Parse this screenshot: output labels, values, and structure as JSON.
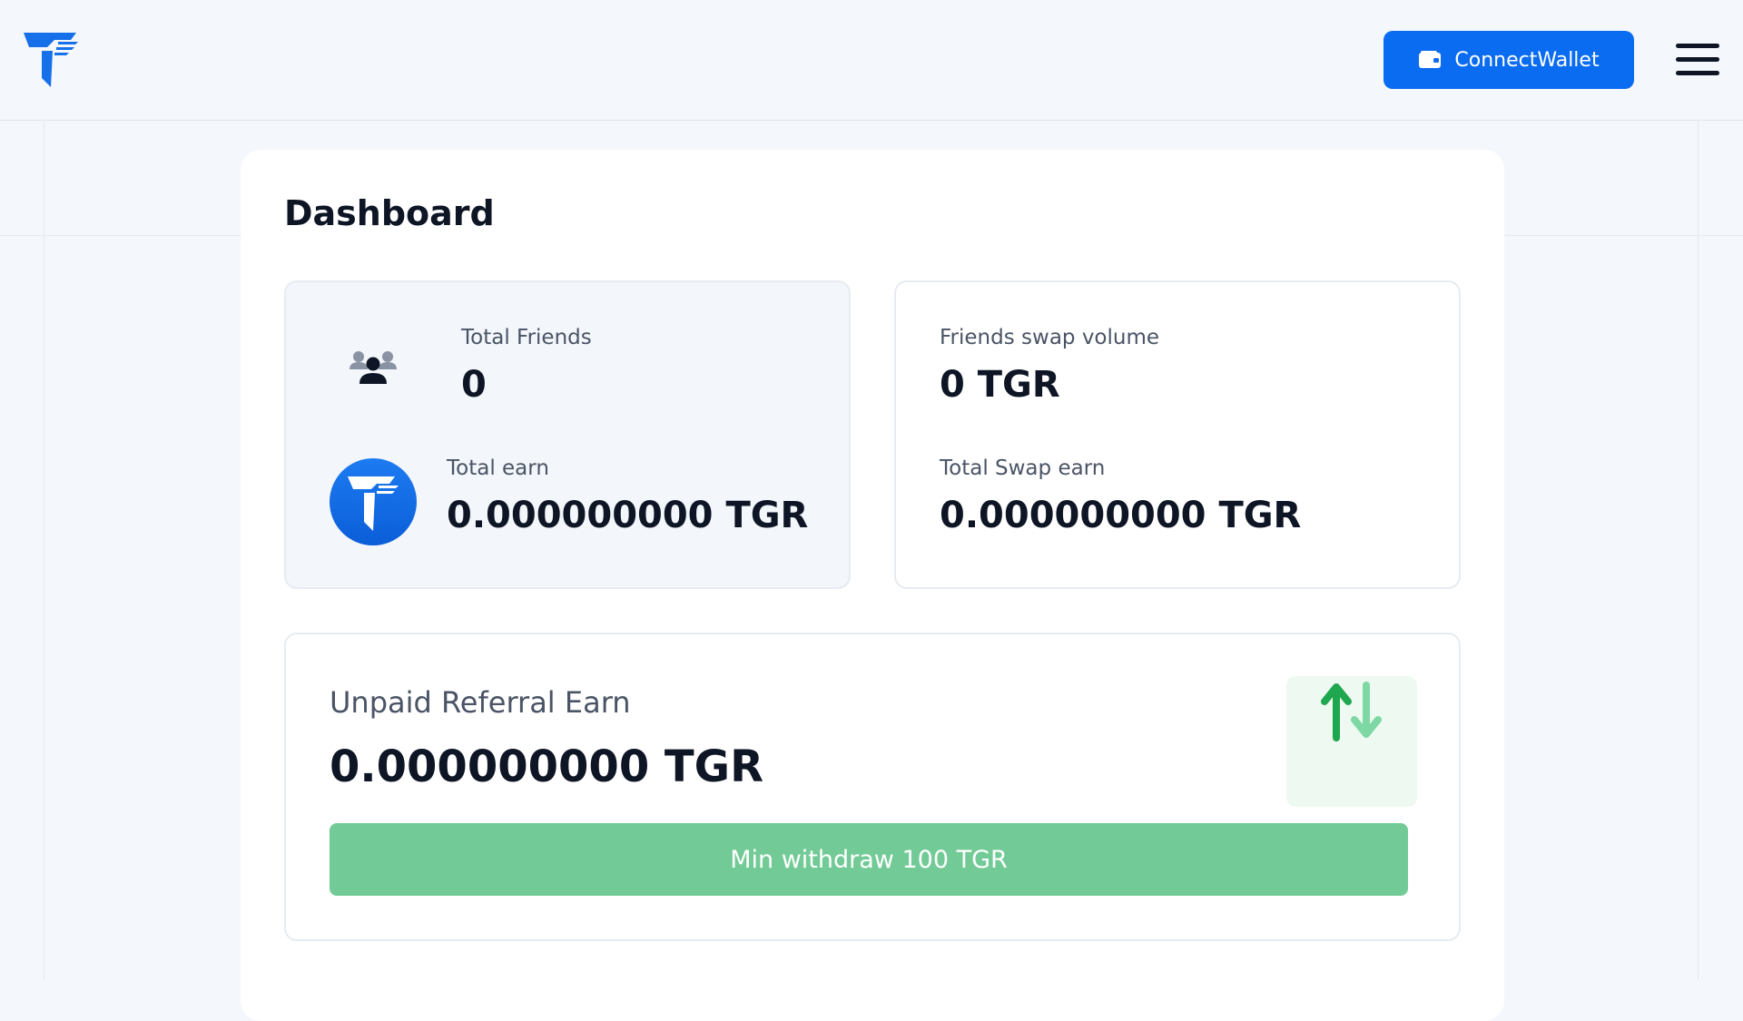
{
  "header": {
    "connect_wallet_label": "ConnectWallet"
  },
  "dashboard": {
    "title": "Dashboard",
    "total_friends": {
      "label": "Total Friends",
      "value": "0"
    },
    "total_earn": {
      "label": "Total earn",
      "value": "0.000000000 TGR"
    },
    "friends_swap_volume": {
      "label": "Friends swap volume",
      "value": "0 TGR"
    },
    "total_swap_earn": {
      "label": "Total Swap earn",
      "value": "0.000000000 TGR"
    },
    "unpaid_referral": {
      "label": "Unpaid Referral Earn",
      "value": "0.000000000 TGR",
      "withdraw_label": "Min withdraw 100 TGR"
    }
  },
  "icons": {
    "logo": "brand-logo-icon",
    "wallet": "wallet-icon",
    "menu": "hamburger-menu-icon",
    "friends": "users-group-icon",
    "token": "tgr-token-icon",
    "swap": "swap-arrows-icon"
  },
  "colors": {
    "accent": "#0a6cf0",
    "withdraw_button": "#72cb96",
    "swap_up_arrow": "#1ea74f",
    "swap_down_arrow": "#7dd8a3",
    "background": "#f4f7fb"
  }
}
